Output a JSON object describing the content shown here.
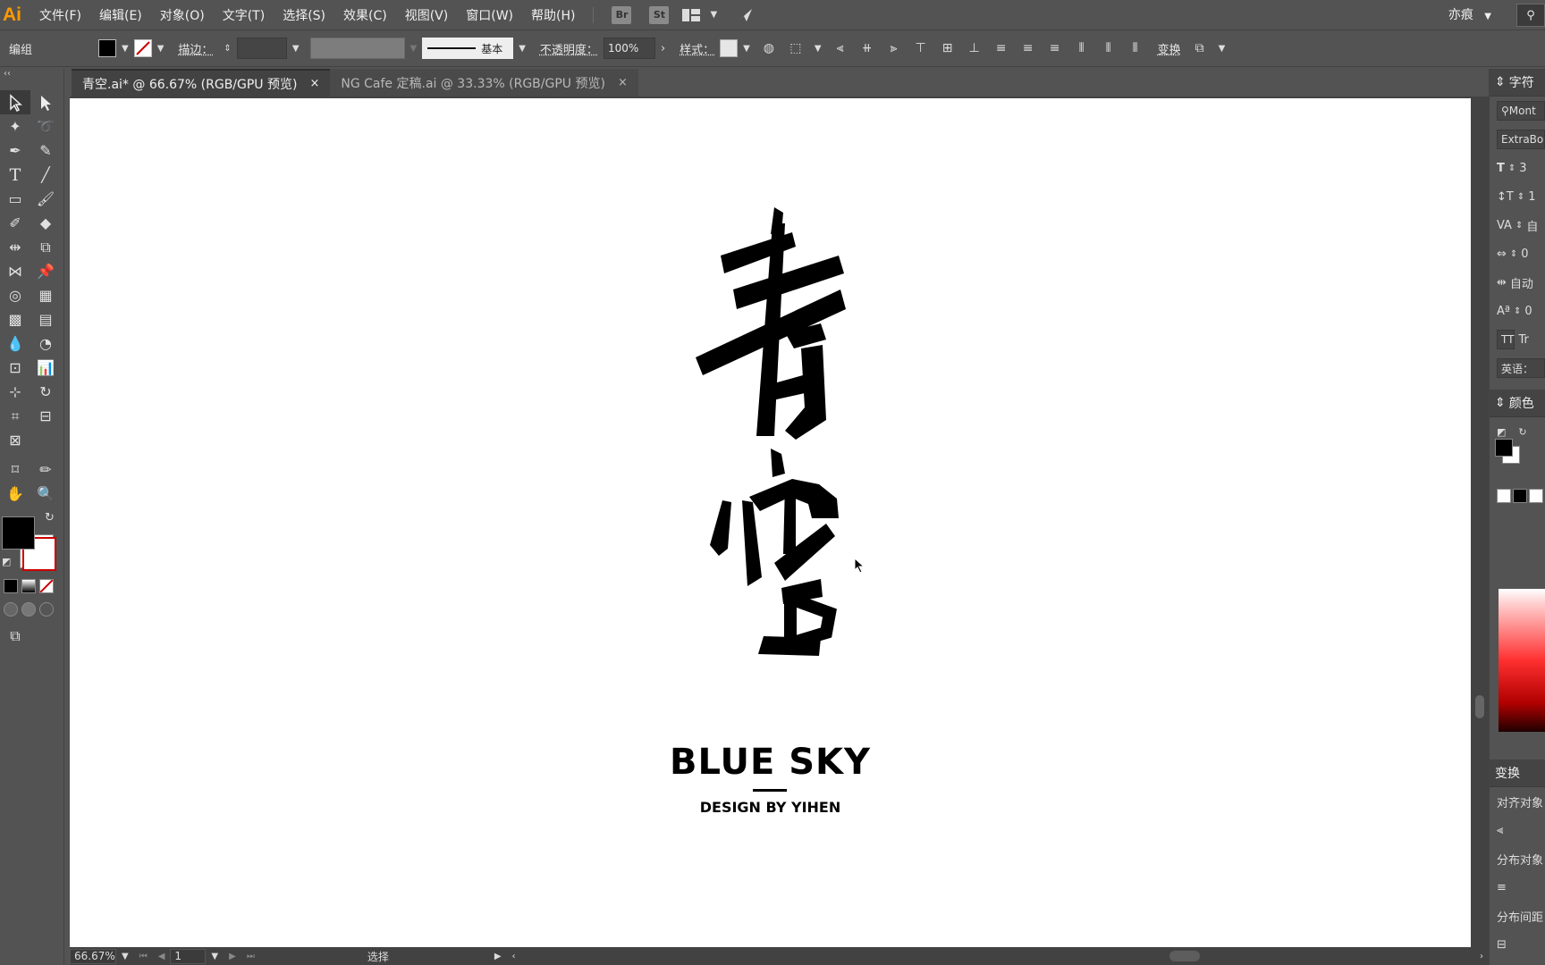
{
  "app": {
    "logo": "Ai"
  },
  "menu": [
    "文件(F)",
    "编辑(E)",
    "对象(O)",
    "文字(T)",
    "选择(S)",
    "效果(C)",
    "视图(V)",
    "窗口(W)",
    "帮助(H)"
  ],
  "menubar_buttons": {
    "bridge": "Br",
    "stock": "St"
  },
  "workspace": "亦痕",
  "control": {
    "selection_label": "编组",
    "stroke_label": "描边：",
    "stroke_profile": "基本",
    "opacity_label": "不透明度：",
    "opacity_value": "100%",
    "style_label": "样式：",
    "transform_label": "变换"
  },
  "tabs": [
    {
      "label": "青空.ai* @ 66.67% (RGB/GPU 预览)",
      "close": "×"
    },
    {
      "label": "NG Cafe 定稿.ai @ 33.33% (RGB/GPU 预览)",
      "close": "×"
    }
  ],
  "artwork": {
    "title": "BLUE SKY",
    "subtitle": "DESIGN BY YIHEN"
  },
  "status": {
    "zoom": "66.67%",
    "page": "1",
    "mode": "选择"
  },
  "panels": {
    "character": {
      "title": "字符",
      "font_family": "Mont",
      "font_style": "ExtraBo",
      "size": "3",
      "leading": "1",
      "kerning": "自",
      "tracking": "0",
      "vscale": "自动",
      "baseline": "0",
      "tt1": "TT",
      "tt2": "Tr",
      "language": "英语："
    },
    "color": {
      "title": "颜色"
    },
    "transform": {
      "title": "变换",
      "align_objects": "对齐对象",
      "distribute_objects": "分布对象",
      "distribute_spacing": "分布间距"
    }
  },
  "colors": {
    "ui_bg": "#535353",
    "canvas": "#ffffff",
    "accent_logo": "#ff9a00"
  }
}
